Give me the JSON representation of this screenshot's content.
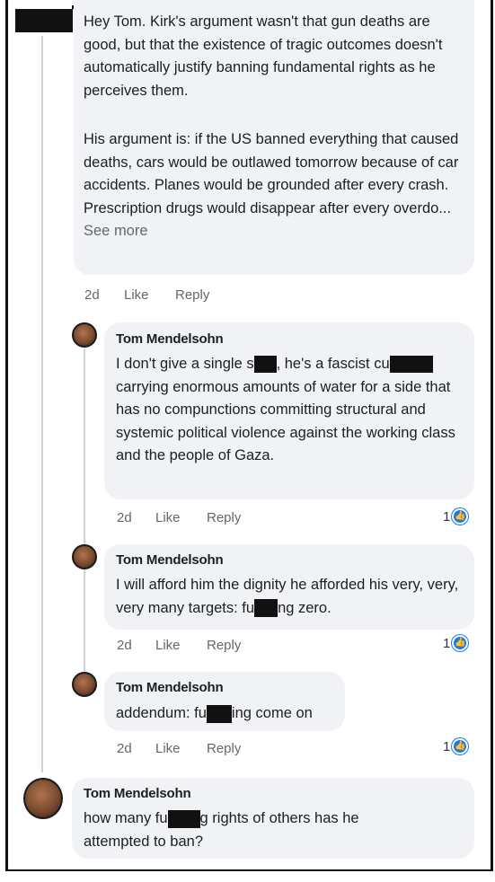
{
  "first_comment": {
    "text_part1": "Hey Tom. Kirk's argument wasn't that gun deaths are good, but that the existence of tragic outcomes doesn't automatically justify banning fundamental rights as he perceives them.",
    "text_part2": "His argument is: if the US banned everything that caused deaths, cars would be outlawed tomorrow because of car accidents. Planes would be grounded after every crash. Prescription drugs would disappear after every overdo...",
    "see_more": "See more",
    "time": "2d",
    "like": "Like",
    "reply": "Reply"
  },
  "replies": [
    {
      "author": "Tom Mendelsohn",
      "text_a": "I don't give a single s",
      "text_b": ", he's a fascist cu",
      "text_c": "carrying enormous amounts of water for a side that has no compunctions committing structural and systemic political violence against the working class and the people of Gaza.",
      "time": "2d",
      "like": "Like",
      "reply": "Reply",
      "reactions": "1"
    },
    {
      "author": "Tom Mendelsohn",
      "text_a": "I will afford him the dignity he afforded his very, very, very many targets: fu",
      "text_b": "ng zero.",
      "time": "2d",
      "like": "Like",
      "reply": "Reply",
      "reactions": "1"
    },
    {
      "author": "Tom Mendelsohn",
      "text_a": "addendum: fu",
      "text_b": "ing come on",
      "time": "2d",
      "like": "Like",
      "reply": "Reply",
      "reactions": "1"
    }
  ],
  "bottom_comment": {
    "author": "Tom Mendelsohn",
    "text_a": "how many fu",
    "text_b": "g rights of others has he attempted to ban?"
  },
  "icons": {
    "reaction": "like-icon",
    "redaction": "black-box"
  },
  "colors": {
    "bubble": "#f0f2f5",
    "meta": "#65676b",
    "like_blue": "#1877f2"
  }
}
